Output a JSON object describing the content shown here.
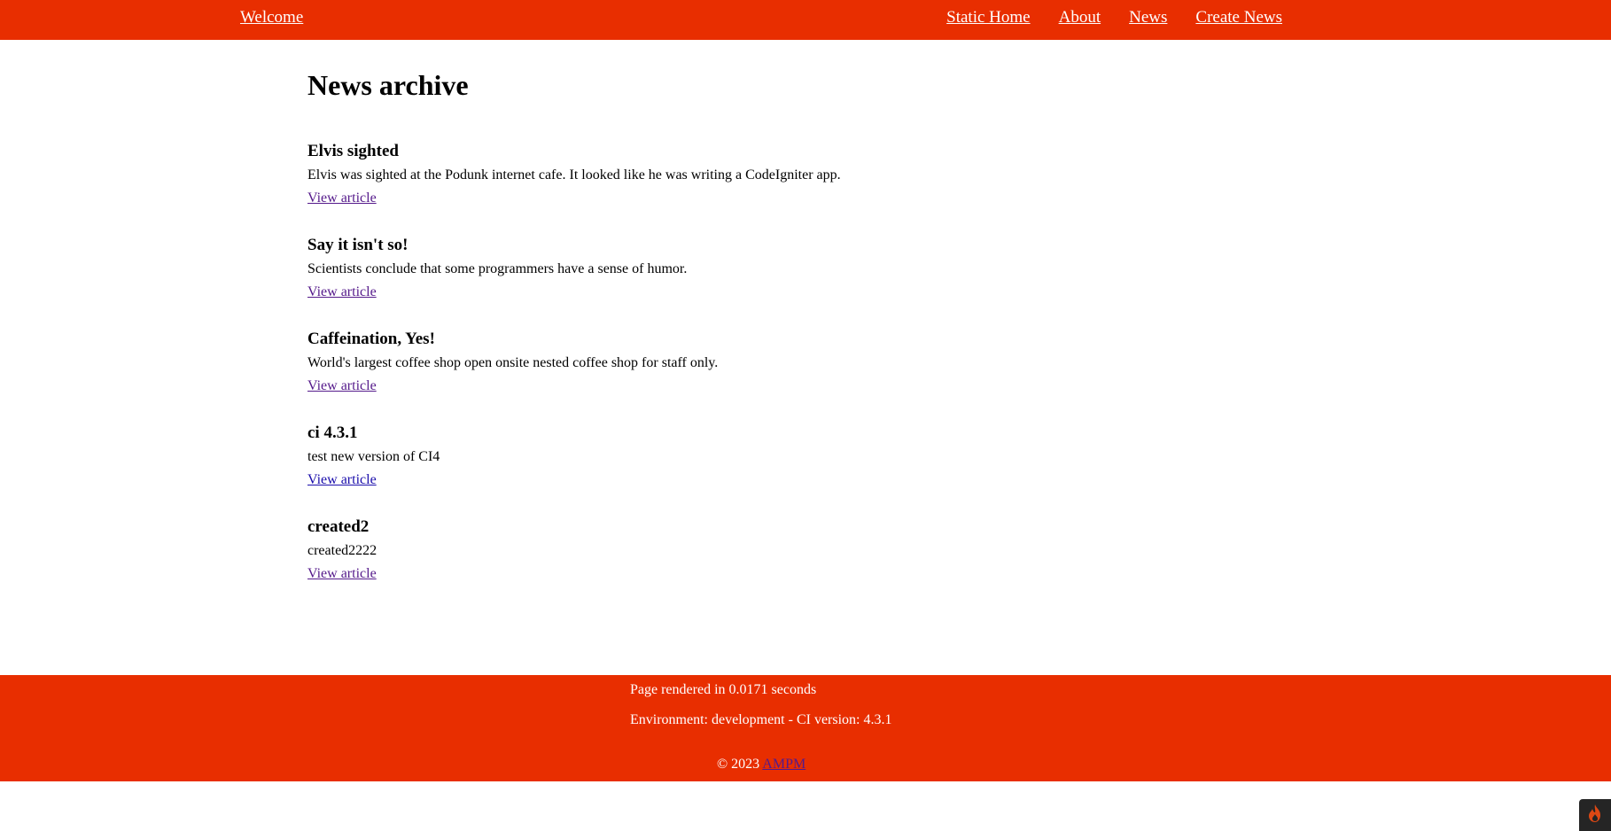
{
  "header": {
    "brand": "Welcome",
    "nav": [
      "Static Home",
      "About",
      "News",
      "Create News"
    ]
  },
  "main": {
    "title": "News archive",
    "articles": [
      {
        "title": "Elvis sighted",
        "body": "Elvis was sighted at the Podunk internet cafe. It looked like he was writing a CodeIgniter app.",
        "link": "View article"
      },
      {
        "title": "Say it isn't so!",
        "body": "Scientists conclude that some programmers have a sense of humor.",
        "link": "View article"
      },
      {
        "title": "Caffeination, Yes!",
        "body": "World's largest coffee shop open onsite nested coffee shop for staff only.",
        "link": "View article"
      },
      {
        "title": "ci 4.3.1",
        "body": "test new version of CI4",
        "link": "View article"
      },
      {
        "title": "created2",
        "body": "created2222",
        "link": "View article"
      }
    ]
  },
  "footer": {
    "rendered": "Page rendered in 0.0171 seconds",
    "environment": "Environment: development - CI version: 4.3.1",
    "copyright_prefix": "© 2023",
    "copyright_link": "AMPM"
  },
  "debug_toolbar": {
    "icon": "codeigniter-flame-icon"
  },
  "colors": {
    "brand_red": "#e82e00",
    "visited_link": "#551a8b",
    "unvisited_link": "#1a0dab",
    "toolbar_dark": "#252525"
  }
}
